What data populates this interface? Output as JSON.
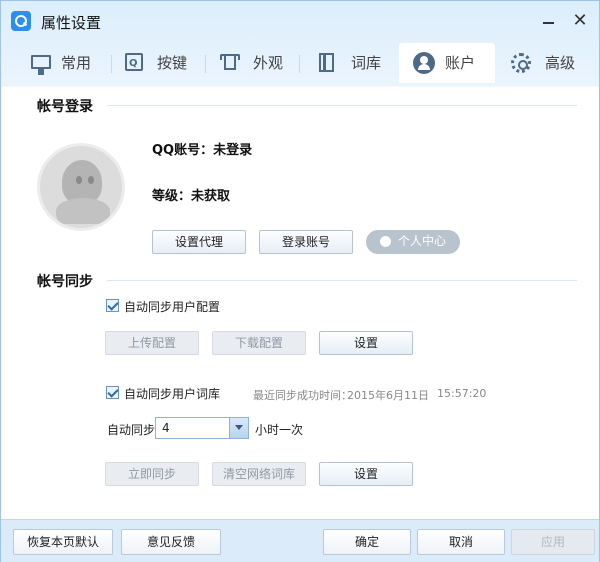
{
  "window": {
    "title": "属性设置"
  },
  "tabs": [
    {
      "label": "常用",
      "icon": "monitor-icon"
    },
    {
      "label": "按键",
      "icon": "key-icon"
    },
    {
      "label": "外观",
      "icon": "shirt-icon"
    },
    {
      "label": "词库",
      "icon": "book-icon"
    },
    {
      "label": "账户",
      "icon": "user-icon",
      "active": true
    },
    {
      "label": "高级",
      "icon": "gear-icon"
    }
  ],
  "login": {
    "section_title": "帐号登录",
    "qq_account": "QQ账号：未登录",
    "level": "等级：未获取",
    "buttons": {
      "proxy": "设置代理",
      "login": "登录账号",
      "profile": "个人中心"
    }
  },
  "sync": {
    "section_title": "帐号同步",
    "config": {
      "checkbox_label": "自动同步用户配置",
      "checked": true,
      "upload": "上传配置",
      "download": "下载配置",
      "settings": "设置"
    },
    "lexicon": {
      "checkbox_label": "自动同步用户词库",
      "checked": true,
      "last_sync_label": "最近同步成功时间：",
      "last_sync_date": "2015年6月11日",
      "last_sync_time": "15:57:20",
      "interval_prefix": "自动同步",
      "interval_value": "4",
      "interval_suffix": "小时一次",
      "sync_now": "立即同步",
      "clear_online": "清空网络词库",
      "settings": "设置"
    }
  },
  "footer": {
    "restore": "恢复本页默认",
    "feedback": "意见反馈",
    "ok": "确定",
    "cancel": "取消",
    "apply": "应用"
  }
}
